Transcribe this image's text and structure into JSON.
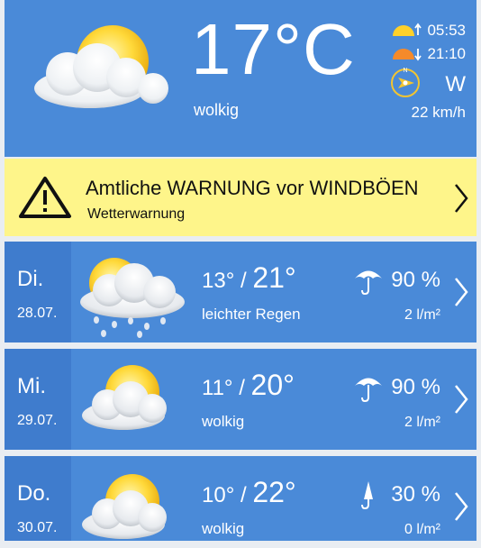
{
  "current": {
    "temperature": "17°C",
    "condition": "wolkig",
    "sunrise": "05:53",
    "sunset": "21:10",
    "wind_direction": "W",
    "wind_speed": "22 km/h"
  },
  "warning": {
    "title": "Amtliche WARNUNG vor WINDBÖEN",
    "subtitle": "Wetterwarnung"
  },
  "forecast": [
    {
      "day": "Di.",
      "date": "28.07.",
      "min": "13°",
      "sep": "/",
      "max": "21°",
      "condition": "leichter Regen",
      "precip_prob": "90 %",
      "precip_amount": "2 l/m²",
      "icon": "cloud-rain-icon"
    },
    {
      "day": "Mi.",
      "date": "29.07.",
      "min": "11°",
      "sep": "/",
      "max": "20°",
      "condition": "wolkig",
      "precip_prob": "90 %",
      "precip_amount": "2 l/m²",
      "icon": "partly-cloudy-icon"
    },
    {
      "day": "Do.",
      "date": "30.07.",
      "min": "10°",
      "sep": "/",
      "max": "22°",
      "condition": "wolkig",
      "precip_prob": "30 %",
      "precip_amount": "0 l/m²",
      "icon": "partly-cloudy-icon"
    }
  ],
  "colors": {
    "panel": "#4a8ad8",
    "day_strip": "#3f7ccd",
    "warning_bg": "#fef58a"
  }
}
